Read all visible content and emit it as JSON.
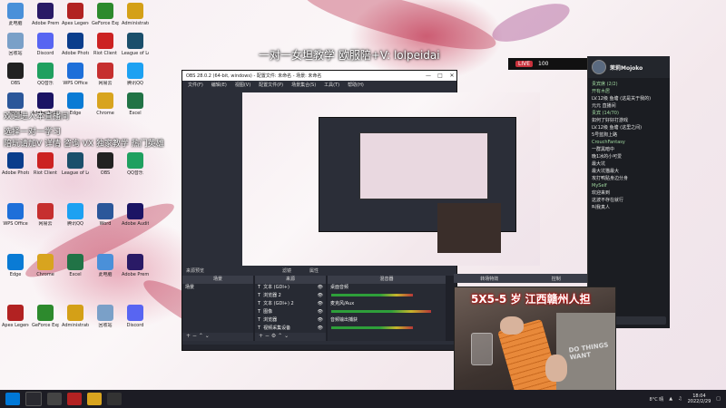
{
  "overlay": {
    "top_text": "一对一女坦教学  欧服陪+V:  lolpeidai",
    "scroll_line1": "欢迎进入本直播间 ",
    "scroll_line2": "选择一对一学习",
    "scroll_line3": "陪玩请加V 详情 咨询 VX 独家教学 热门英雄"
  },
  "desktop_icons": [
    {
      "label": "此电脑",
      "color": "#4a90d9"
    },
    {
      "label": "Adobe Premiere",
      "color": "#2a1a66"
    },
    {
      "label": "Apex Legends",
      "color": "#b22222"
    },
    {
      "label": "GeForce Experience",
      "color": "#2d8a2d"
    },
    {
      "label": "Administrator",
      "color": "#d4a017"
    },
    {
      "label": "回收站",
      "color": "#7aa0c8"
    },
    {
      "label": "Discord",
      "color": "#5865f2"
    },
    {
      "label": "Adobe Photoshop",
      "color": "#0b3d8c"
    },
    {
      "label": "Riot Client",
      "color": "#c22"
    },
    {
      "label": "League of Legends",
      "color": "#1b4f6b"
    },
    {
      "label": "OBS",
      "color": "#222"
    },
    {
      "label": "QQ音乐",
      "color": "#20a060"
    },
    {
      "label": "WPS Office",
      "color": "#1e6fd9"
    },
    {
      "label": "网易云",
      "color": "#c62f2f"
    },
    {
      "label": "腾讯QQ",
      "color": "#1da1f2"
    },
    {
      "label": "Word",
      "color": "#2b579a"
    },
    {
      "label": "Adobe Audition",
      "color": "#1b1464"
    },
    {
      "label": "Edge",
      "color": "#0a7bd5"
    },
    {
      "label": "Chrome",
      "color": "#d8a41f"
    },
    {
      "label": "Excel",
      "color": "#217346"
    }
  ],
  "streambar": {
    "live": "LIVE",
    "count": "100"
  },
  "obs": {
    "title": "OBS 28.0.2 (64-bit, windows) - 配置文件: 未命名 - 场景: 未命名",
    "menu": [
      "文件(F)",
      "编辑(E)",
      "视图(V)",
      "配置文件(P)",
      "场景集合(S)",
      "工具(T)",
      "帮助(H)"
    ],
    "docks": {
      "scenes": {
        "title": "场景",
        "items": [
          "场景"
        ]
      },
      "sources": {
        "title": "来源",
        "items": [
          "文本 (GDI+)",
          "浏览器 2",
          "文本 (GDI+) 2",
          "图像",
          "浏览器",
          "视频采集设备"
        ]
      },
      "mixer": {
        "title": "混音器",
        "items": [
          "桌面音频",
          "麦克风/Aux",
          "音频输出捕获"
        ]
      },
      "transitions": {
        "title": "转场特效"
      },
      "controls": {
        "title": "控制"
      }
    },
    "selected_source_hint": "来源预览",
    "filter_label": "滤镜",
    "properties_label": "属性"
  },
  "chat": {
    "channel_name": "茉莉Mojoko",
    "messages": [
      {
        "user": "贵宾席 (2/2)",
        "text": ""
      },
      {
        "user": "开有木居",
        "text": "LV.12级  鱼塘 (这是关于我的)"
      },
      {
        "user": "",
        "text": "元元 直播间"
      },
      {
        "user": "贵宾 (14/70)",
        "text": ""
      },
      {
        "user": "",
        "text": "如何了好好打游戏"
      },
      {
        "user": "",
        "text": "LV.12级  鱼塘 (这里之间)"
      },
      {
        "user": "",
        "text": "5号蓝狗上路"
      },
      {
        "user": "CrouchFantasy",
        "text": "一群黑暗中"
      },
      {
        "user": "",
        "text": "晚1冰的小可爱"
      },
      {
        "user": "",
        "text": "最大坑"
      },
      {
        "user": "",
        "text": "最大坑猫最大"
      },
      {
        "user": "",
        "text": "攻打鸭贴身边分身"
      },
      {
        "user": "MySelf",
        "text": "欢迎来到"
      },
      {
        "user": "",
        "text": "这波不存在就行"
      },
      {
        "user": "",
        "text": "叫我真人"
      }
    ]
  },
  "webcam": {
    "title": "5X5-5 岁 江西赣州人担",
    "shirt_text": "DO THINGS WANT"
  },
  "taskbar": {
    "weather": "8°C 晴",
    "time": "18:04",
    "date": "2022/2/29"
  }
}
